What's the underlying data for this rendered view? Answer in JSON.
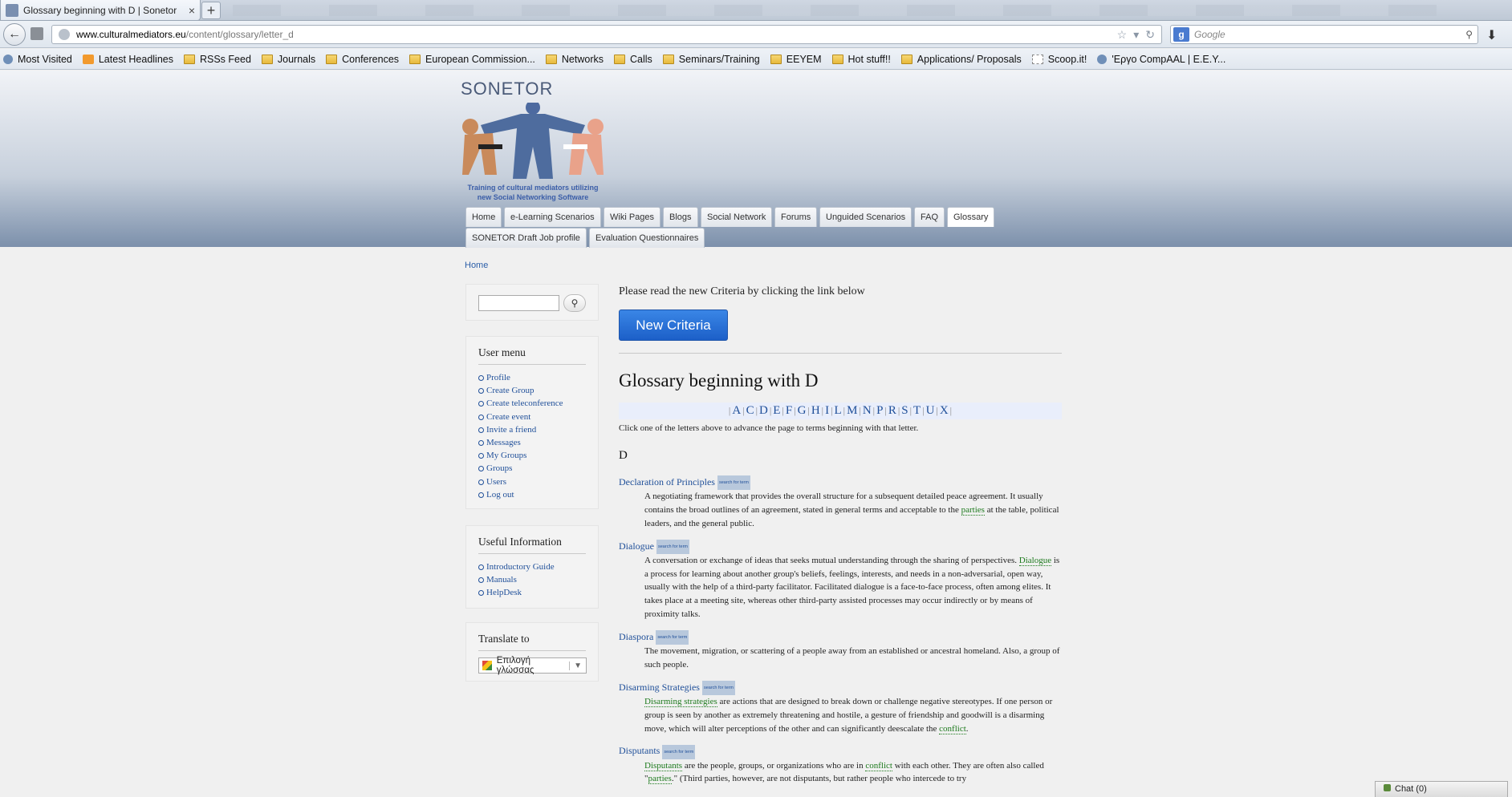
{
  "browser": {
    "tab_title": "Glossary beginning with D | Sonetor",
    "tab_close": "×",
    "new_tab": "+",
    "url_domain": "www.culturalmediators.eu",
    "url_path": "/content/glossary/letter_d",
    "search_placeholder": "Google",
    "bookmarks": [
      {
        "label": "Most Visited",
        "icon": "globe-icon"
      },
      {
        "label": "Latest Headlines",
        "icon": "rss-icon"
      },
      {
        "label": "RSSs Feed",
        "icon": "folder-icon"
      },
      {
        "label": "Journals",
        "icon": "folder-icon"
      },
      {
        "label": "Conferences",
        "icon": "folder-icon"
      },
      {
        "label": "European Commission...",
        "icon": "folder-icon"
      },
      {
        "label": "Networks",
        "icon": "folder-icon"
      },
      {
        "label": "Calls",
        "icon": "folder-icon"
      },
      {
        "label": "Seminars/Training",
        "icon": "folder-icon"
      },
      {
        "label": "EEYEM",
        "icon": "folder-icon"
      },
      {
        "label": "Hot stuff!!",
        "icon": "folder-icon"
      },
      {
        "label": "Applications/ Proposals",
        "icon": "folder-icon"
      },
      {
        "label": "Scoop.it!",
        "icon": "page-icon"
      },
      {
        "label": "'Εργο CompAAL | E.E.Y...",
        "icon": "globe-icon"
      }
    ]
  },
  "site": {
    "logo_text": "SONETOR",
    "tagline_line1": "Training of cultural mediators utilizing",
    "tagline_line2": "new Social Networking Software",
    "menu": [
      {
        "label": "Home",
        "active": false
      },
      {
        "label": "e-Learning Scenarios",
        "active": false
      },
      {
        "label": "Wiki Pages",
        "active": false
      },
      {
        "label": "Blogs",
        "active": false
      },
      {
        "label": "Social Network",
        "active": false
      },
      {
        "label": "Forums",
        "active": false
      },
      {
        "label": "Unguided Scenarios",
        "active": false
      },
      {
        "label": "FAQ",
        "active": false
      },
      {
        "label": "Glossary",
        "active": true
      },
      {
        "label": "SONETOR Draft Job profile",
        "active": false
      },
      {
        "label": "Evaluation Questionnaires",
        "active": false
      }
    ]
  },
  "breadcrumb": "Home",
  "sidebar": {
    "user_menu_title": "User menu",
    "user_menu": [
      "Profile",
      "Create Group",
      "Create teleconference",
      "Create event",
      "Invite a friend",
      "Messages",
      "My Groups",
      "Groups",
      "Users",
      "Log out"
    ],
    "info_title": "Useful Information",
    "info_items": [
      "Introductory Guide",
      "Manuals",
      "HelpDesk"
    ],
    "translate_title": "Translate to",
    "translate_select": "Επιλογή γλώσσας"
  },
  "main": {
    "notice": "Please read the new Criteria by clicking the link below",
    "criteria_button": "New Criteria",
    "title": "Glossary beginning with D",
    "letters": [
      "A",
      "C",
      "D",
      "E",
      "F",
      "G",
      "H",
      "I",
      "L",
      "M",
      "N",
      "P",
      "R",
      "S",
      "T",
      "U",
      "X"
    ],
    "letter_hint": "Click one of the letters above to advance the page to terms beginning with that letter.",
    "section_letter": "D",
    "search_for_term": "search for term",
    "entries": [
      {
        "term": "Declaration of Principles",
        "def": [
          {
            "t": "A negotiating framework that provides the overall structure for a subsequent detailed peace agreement. It usually contains the broad outlines of an agreement, stated in general terms and acceptable to the "
          },
          {
            "g": "parties"
          },
          {
            "t": " at the table, political leaders, and the general public."
          }
        ]
      },
      {
        "term": "Dialogue",
        "def": [
          {
            "t": "A conversation or exchange of ideas that seeks mutual understanding through the sharing of perspectives. "
          },
          {
            "g": "Dialogue"
          },
          {
            "t": " is a process for learning about another group's beliefs, feelings, interests, and needs in a non-adversarial, open way, usually with the help of a third-party facilitator. Facilitated dialogue is a face-to-face process, often among elites. It takes place at a meeting site, whereas other third-party assisted processes may occur indirectly or by means of proximity talks."
          }
        ]
      },
      {
        "term": "Diaspora",
        "def": [
          {
            "t": "The movement, migration, or scattering of a people away from an established or ancestral homeland. Also, a group of such people."
          }
        ]
      },
      {
        "term": "Disarming Strategies",
        "def": [
          {
            "g": "Disarming strategies"
          },
          {
            "t": " are actions that are designed to break down or challenge negative stereotypes. If one person or group is seen by another as extremely threatening and hostile, a gesture of friendship and goodwill is a disarming move, which will alter perceptions of the other and can significantly deescalate the "
          },
          {
            "g": "conflict"
          },
          {
            "t": "."
          }
        ]
      },
      {
        "term": "Disputants",
        "def": [
          {
            "g": "Disputants"
          },
          {
            "t": " are the people, groups, or organizations who are in "
          },
          {
            "g": "conflict"
          },
          {
            "t": " with each other. They are often also called \""
          },
          {
            "g": "parties"
          },
          {
            "t": ".\" (Third parties, however, are not disputants, but rather people who intercede to try"
          }
        ]
      }
    ]
  },
  "chat_label": "Chat (0)"
}
